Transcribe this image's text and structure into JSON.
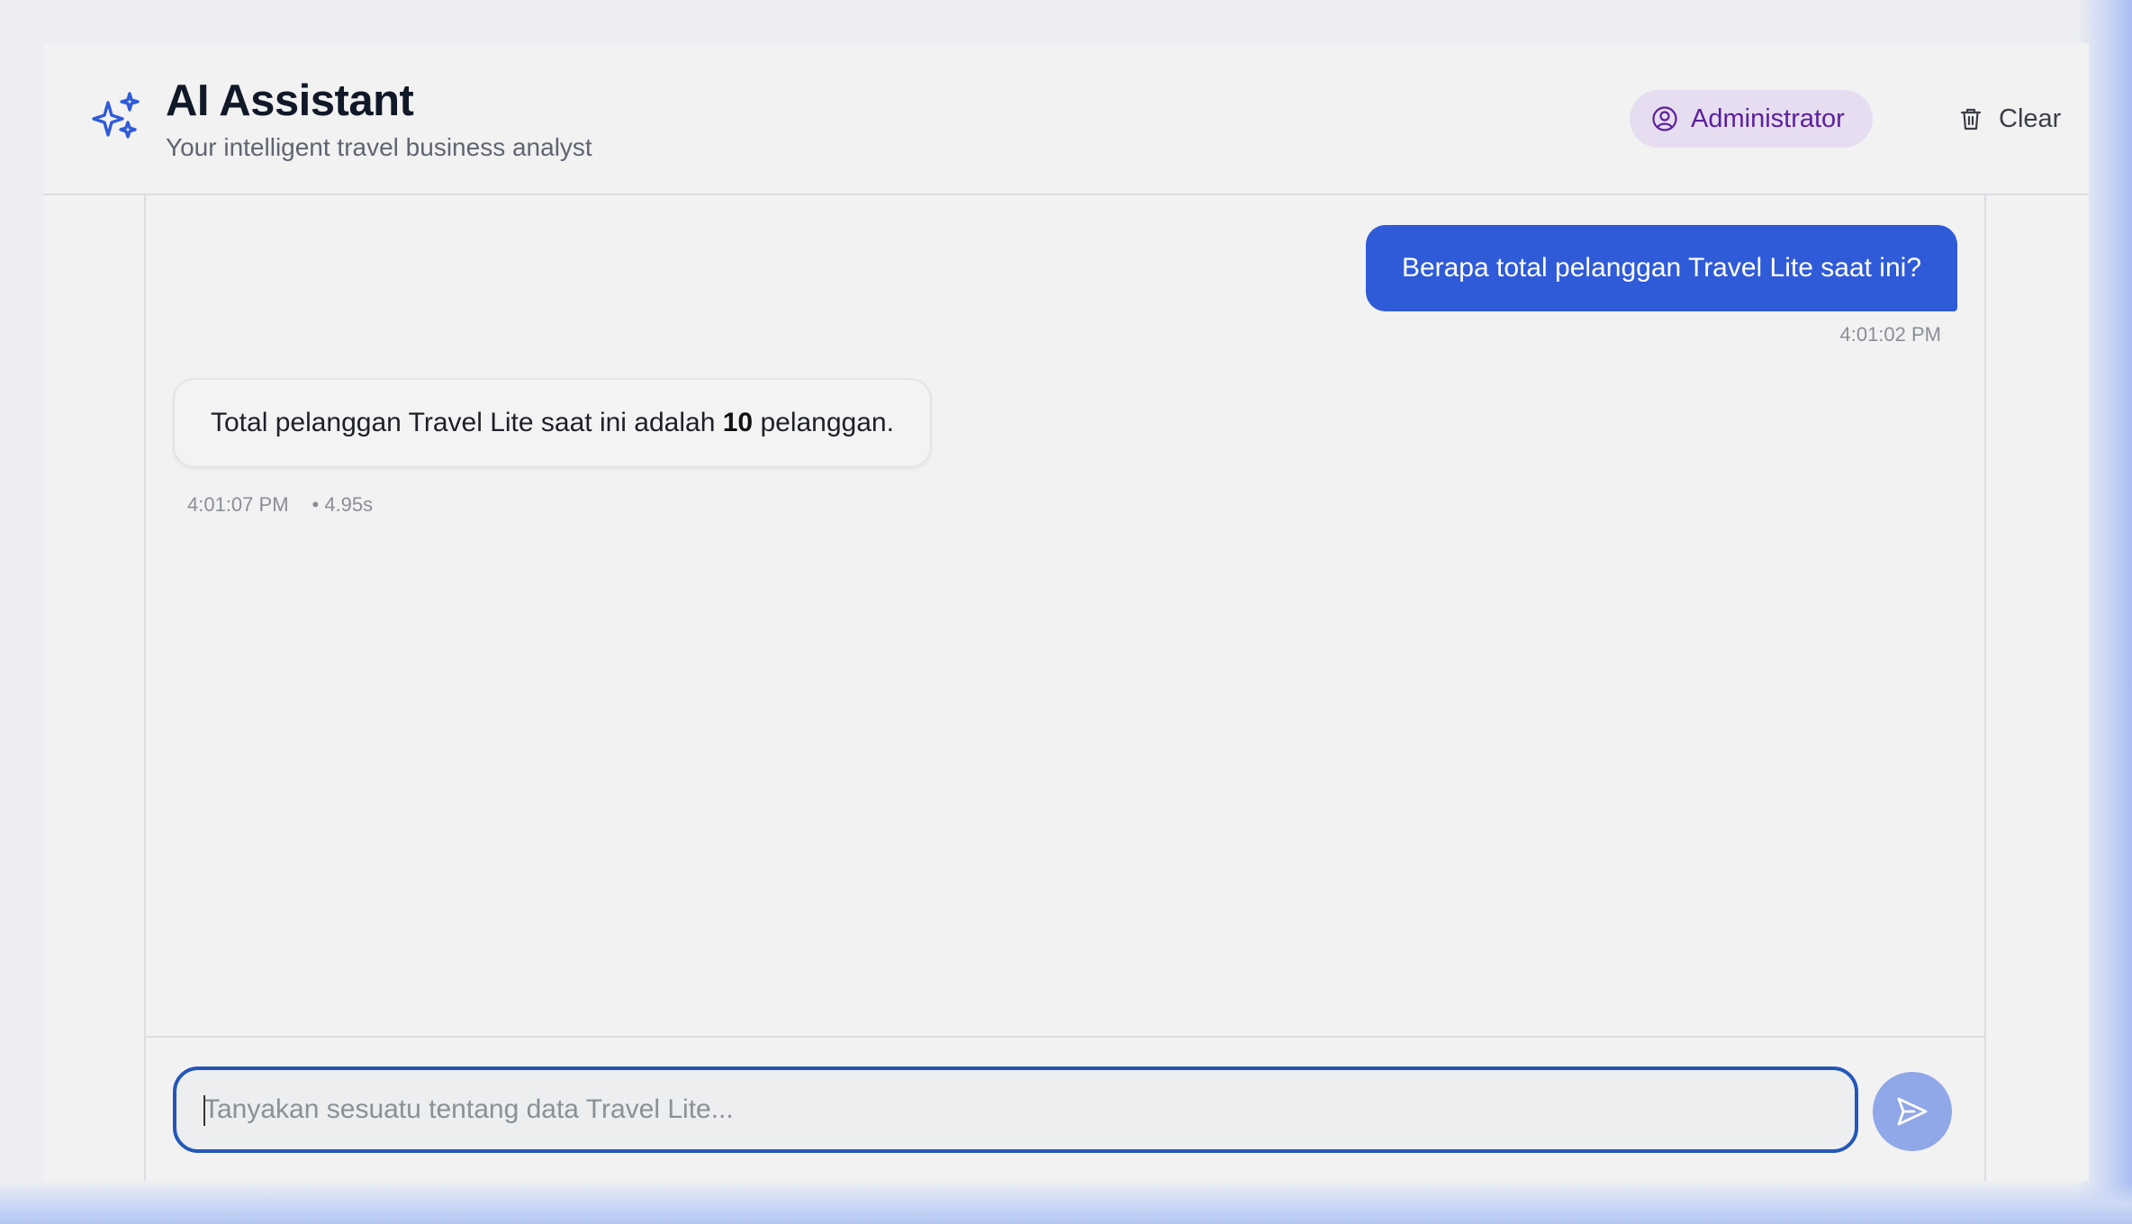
{
  "header": {
    "title": "AI Assistant",
    "subtitle": "Your intelligent travel business analyst",
    "role_badge": "Administrator",
    "clear_label": "Clear"
  },
  "messages": [
    {
      "sender": "user",
      "text": "Berapa total pelanggan Travel Lite saat ini?",
      "time": "4:01:02 PM"
    },
    {
      "sender": "assistant",
      "text_before": "Total pelanggan Travel Lite saat ini adalah ",
      "text_bold": "10",
      "text_after": " pelanggan.",
      "time": "4:01:07 PM",
      "duration": "• 4.95s"
    }
  ],
  "composer": {
    "placeholder": "Tanyakan sesuatu tentang data Travel Lite..."
  },
  "icons": {
    "logo": "sparkles-icon",
    "role": "user-circle-icon",
    "clear": "trash-icon",
    "send": "send-icon"
  },
  "colors": {
    "accent": "#2f5bd8",
    "badge_bg": "#e6ddf0",
    "badge_text": "#5b1f9c",
    "input_border": "#2456b8",
    "send_bg": "#90a7e8"
  }
}
